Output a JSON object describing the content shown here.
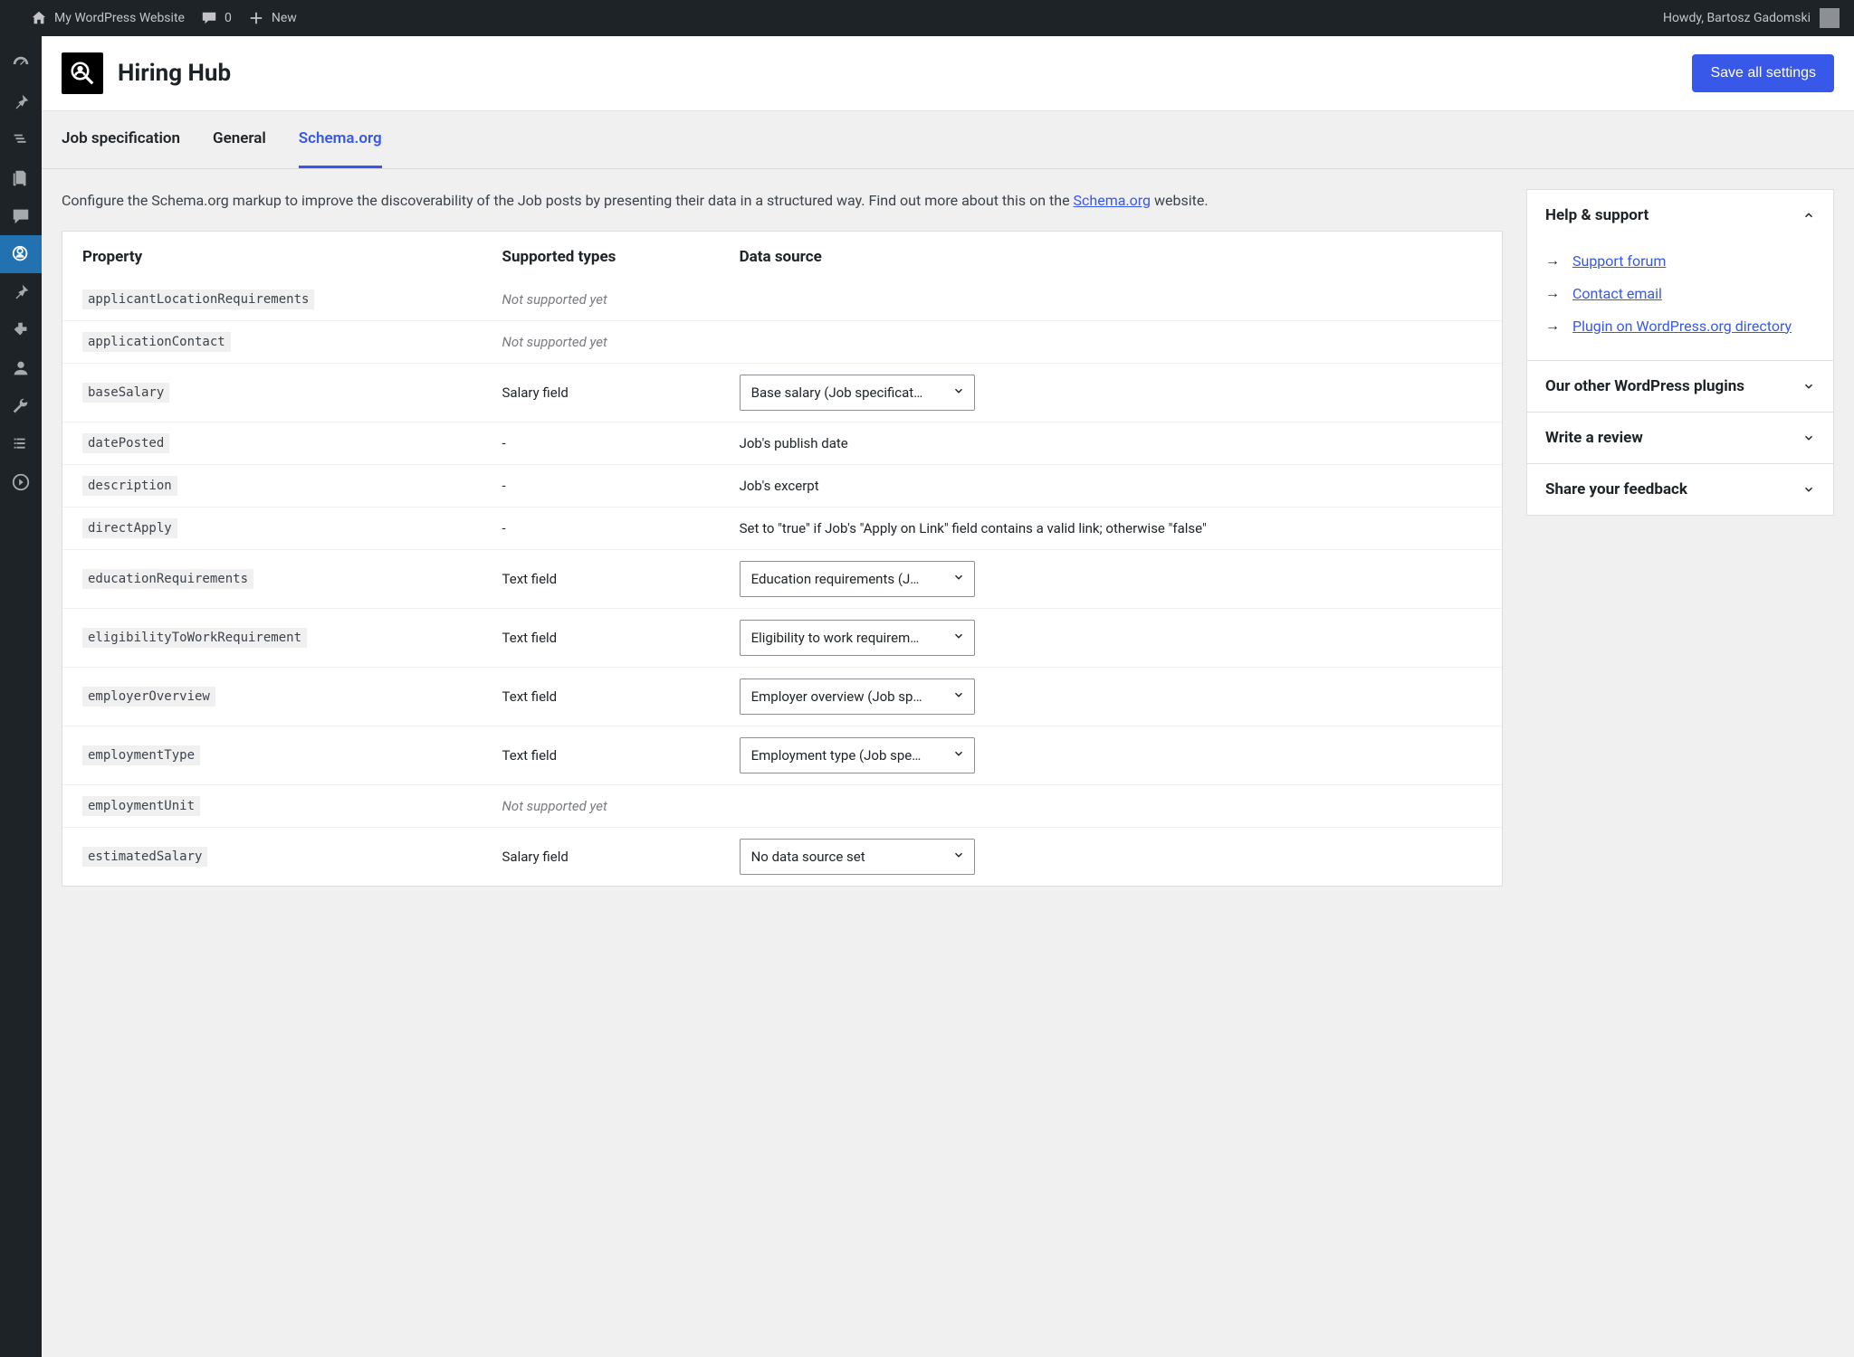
{
  "adminBar": {
    "siteName": "My WordPress Website",
    "commentsCount": "0",
    "newLabel": "New",
    "greeting": "Howdy, Bartosz Gadomski"
  },
  "header": {
    "title": "Hiring Hub",
    "saveLabel": "Save all settings"
  },
  "tabs": [
    {
      "label": "Job specification",
      "active": false
    },
    {
      "label": "General",
      "active": false
    },
    {
      "label": "Schema.org",
      "active": true
    }
  ],
  "intro": {
    "text1": "Configure the Schema.org markup to improve the discoverability of the Job posts by presenting their data in a structured way. Find out more about this on the ",
    "linkText": "Schema.org",
    "text2": " website."
  },
  "tableHeaders": {
    "property": "Property",
    "supportedTypes": "Supported types",
    "dataSource": "Data source"
  },
  "rows": [
    {
      "property": "applicantLocationRequirements",
      "types": "Not supported yet",
      "typesStyle": "unsupported"
    },
    {
      "property": "applicationContact",
      "types": "Not supported yet",
      "typesStyle": "unsupported"
    },
    {
      "property": "baseSalary",
      "types": "Salary field",
      "select": "Base salary (Job specificat…"
    },
    {
      "property": "datePosted",
      "types": "-",
      "plain": "Job's publish date"
    },
    {
      "property": "description",
      "types": "-",
      "plain": "Job's excerpt"
    },
    {
      "property": "directApply",
      "types": "-",
      "plain": "Set to \"true\" if Job's \"Apply on Link\" field contains a valid link; otherwise \"false\""
    },
    {
      "property": "educationRequirements",
      "types": "Text field",
      "select": "Education requirements (J…"
    },
    {
      "property": "eligibilityToWorkRequirement",
      "types": "Text field",
      "select": "Eligibility to work requirem…"
    },
    {
      "property": "employerOverview",
      "types": "Text field",
      "select": "Employer overview (Job sp…"
    },
    {
      "property": "employmentType",
      "types": "Text field",
      "select": "Employment type (Job spe…"
    },
    {
      "property": "employmentUnit",
      "types": "Not supported yet",
      "typesStyle": "unsupported"
    },
    {
      "property": "estimatedSalary",
      "types": "Salary field",
      "select": "No data source set"
    }
  ],
  "aside": {
    "panels": [
      {
        "title": "Help & support",
        "expanded": true,
        "links": [
          "Support forum",
          "Contact email",
          "Plugin on WordPress.org directory"
        ]
      },
      {
        "title": "Our other WordPress plugins",
        "expanded": false
      },
      {
        "title": "Write a review",
        "expanded": false
      },
      {
        "title": "Share your feedback",
        "expanded": false
      }
    ]
  }
}
